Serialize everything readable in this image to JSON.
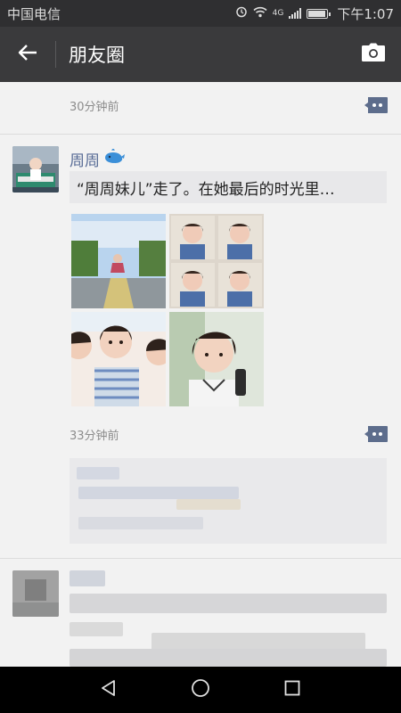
{
  "status_bar": {
    "carrier": "中国电信",
    "network": "4G",
    "time": "下午1:07"
  },
  "header": {
    "title": "朋友圈",
    "back_icon": "arrow-left-icon",
    "camera_icon": "camera-icon"
  },
  "feed": {
    "posts": [
      {
        "timestamp": "30分钟前"
      },
      {
        "author": "周周",
        "author_badge": "whale-emoji",
        "share_title": "“周周妹儿”走了。在她最后的时光里…",
        "photo_count": 4,
        "timestamp": "33分钟前"
      }
    ]
  },
  "colors": {
    "status_bar_bg": "#2f2f31",
    "title_bar_bg": "#3a3a3c",
    "feed_bg": "#f2f2f2",
    "username": "#576b95",
    "comment_icon": "#5d6d8c"
  }
}
